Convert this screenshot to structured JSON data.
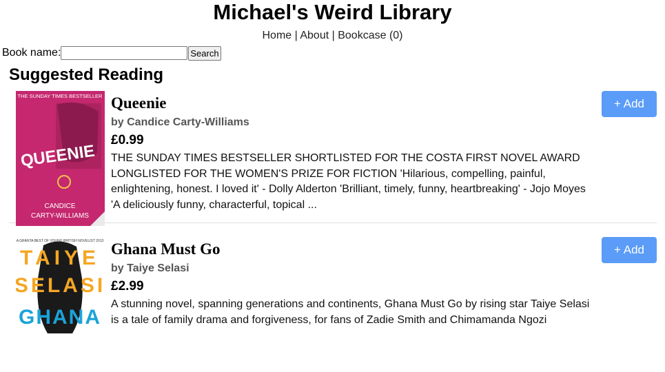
{
  "header": {
    "site_title": "Michael's Weird Library",
    "nav": {
      "home": "Home",
      "about": "About",
      "bookcase": "Bookcase (0)",
      "separator": "|"
    }
  },
  "search": {
    "label": "Book name:",
    "value": "",
    "button_label": "Search"
  },
  "section": {
    "title": "Suggested Reading"
  },
  "books": [
    {
      "title": "Queenie",
      "author": "by Candice Carty-Williams",
      "price": "£0.99",
      "description": "THE SUNDAY TIMES BESTSELLER SHORTLISTED FOR THE COSTA FIRST NOVEL AWARD LONGLISTED FOR THE WOMEN'S PRIZE FOR FICTION 'Hilarious, compelling, painful, enlightening, honest. I loved it' - Dolly Alderton 'Brilliant, timely, funny, heartbreaking' - Jojo Moyes 'A deliciously funny, characterful, topical ...",
      "add_label": "+ Add",
      "cover": {
        "top_text": "THE SUNDAY TIMES BESTSELLER",
        "title_text": "QUEENIE",
        "author_line1": "CANDICE",
        "author_line2": "CARTY-WILLIAMS",
        "bg_color": "#c5286f"
      }
    },
    {
      "title": "Ghana Must Go",
      "author": "by Taiye Selasi",
      "price": "£2.99",
      "description": "A stunning novel, spanning generations and continents, Ghana Must Go by rising star Taiye Selasi is a tale of family drama and forgiveness, for fans of Zadie Smith and Chimamanda Ngozi",
      "add_label": "+ Add",
      "cover": {
        "top_text": "A GRANTA BEST OF YOUNG BRITISH NOVELIST 2013",
        "line1": "TAIYE",
        "line2": "SELASI",
        "line3": "GHANA",
        "accent_color": "#f5a623"
      }
    }
  ]
}
